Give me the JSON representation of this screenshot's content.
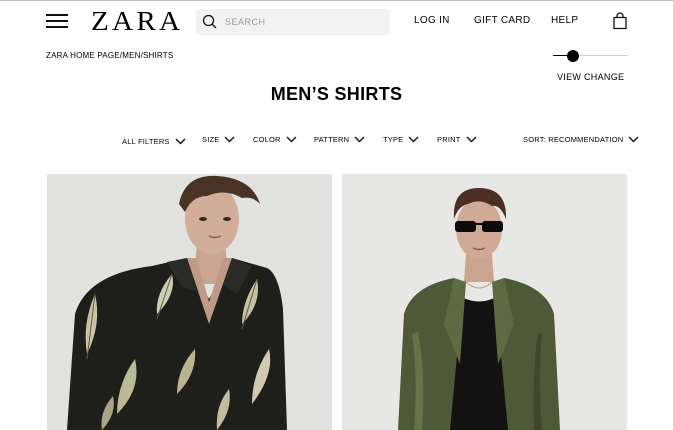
{
  "header": {
    "logo": "ZARA",
    "search_placeholder": "SEARCH",
    "login_label": "LOG IN",
    "giftcard_label": "GIFT CARD",
    "help_label": "HELP"
  },
  "breadcrumb": "ZARA HOME PAGE/MEN/SHIRTS",
  "view_slider": {
    "label": "VIEW CHANGE",
    "value": 0.27
  },
  "page_title": "MEN’S SHIRTS",
  "filters": {
    "all": "ALL FILTERS",
    "size": "SIZE",
    "color": "COLOR",
    "pattern": "PATTERN",
    "type": "TYPE",
    "print": "PRINT",
    "sort": "SORT: RECOMMENDATION"
  },
  "colors": {
    "text": "#000000",
    "search_bg": "#f2f2f2",
    "card_bg": "#e4e4e4",
    "shirt_dark": "#1c1d19",
    "shirt_olive": "#4f5a36"
  },
  "icons": [
    "hamburger-menu-icon",
    "search-icon",
    "shopping-bag-icon",
    "chevron-down-icon"
  ]
}
